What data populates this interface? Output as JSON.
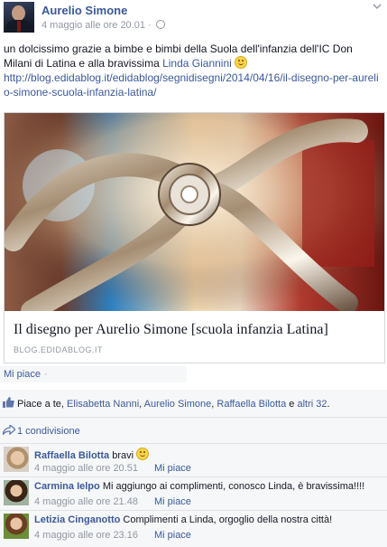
{
  "post": {
    "author": "Aurelio Simone",
    "timestamp": "4 maggio alle ore 20.01",
    "meta_separator": "·",
    "privacy_icon": "globe-icon",
    "options_icon": "chevron-down-icon",
    "text_before_mention": "un dolcissimo grazie a bimbe e bimbi della Suola dell'infanzia dell'IC Don Milani di Latina e alla bravissima ",
    "mention": "Linda Giannini",
    "url": "http://blog.edidablog.it/edidablog/segnidisegni/2014/04/16/il-disegno-per-aurelio-simone-scuola-infanzia-latina/"
  },
  "link_card": {
    "title": "Il disegno per Aurelio Simone [scuola infanzia Latina]",
    "domain": "BLOG.EDIDABLOG.IT"
  },
  "actions": {
    "like_label": "Mi piace",
    "separator": "·"
  },
  "likes": {
    "prefix": "Piace a te, ",
    "people": [
      "Elisabetta Nanni",
      "Aurelio Simone",
      "Raffaella Bilotta"
    ],
    "comma": ", ",
    "conjunction": " e ",
    "others": "altri 32",
    "suffix": "."
  },
  "shares": {
    "label": "1 condivisione"
  },
  "comments": [
    {
      "name": "Raffaella Bilotta",
      "text": "bravi",
      "smiley": true,
      "timestamp": "4 maggio alle ore 20.51",
      "like_label": "Mi piace"
    },
    {
      "name": "Carmina Ielpo",
      "text": "Mi aggiungo ai complimenti, conosco Linda, è bravissima!!!!",
      "smiley": false,
      "timestamp": "4 maggio alle ore 21.48",
      "like_label": "Mi piace"
    },
    {
      "name": "Letizia Cinganotto",
      "text": "Complimenti a Linda, orgoglio della nostra città!",
      "smiley": false,
      "timestamp": "4 maggio alle ore 23.16",
      "like_label": "Mi piace"
    }
  ],
  "colors": {
    "link": "#3b5998",
    "text": "#141823",
    "meta": "#9197a3",
    "footer_bg": "#f6f7f8"
  }
}
